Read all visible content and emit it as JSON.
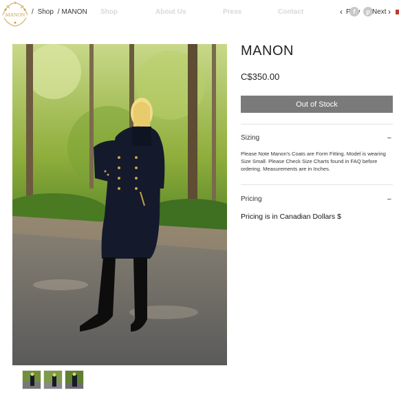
{
  "brand": {
    "logo_text": "MANON",
    "gold": "#c9a24a"
  },
  "breadcrumb": {
    "sep": "/",
    "shop": "Shop",
    "current": "MANON"
  },
  "nav": {
    "shop": "Shop",
    "about": "About Us",
    "press": "Press",
    "contact": "Contact"
  },
  "social": {
    "facebook": "f",
    "pinterest": "p"
  },
  "pager": {
    "prev": "Prev",
    "next": "Next"
  },
  "product": {
    "title": "MANON",
    "price": "C$350.00",
    "stock_button": "Out of Stock",
    "sizing": {
      "heading": "Sizing",
      "toggle": "−",
      "text": "Please Note Manon's Coats are Form Fitting.  Model is wearing Size Small.  Please Check Size Charts found in FAQ before ordering.  Measurements are in Inches."
    },
    "pricing": {
      "heading": "Pricing",
      "toggle": "−",
      "text": "Pricing is in Canadian  Dollars $"
    },
    "thumbnail_count": 3
  },
  "colors": {
    "button": "#7a7a7a",
    "divider": "#e2e2e2",
    "nav_link": "#d8d8d8",
    "cart_badge": "#c0392b"
  }
}
